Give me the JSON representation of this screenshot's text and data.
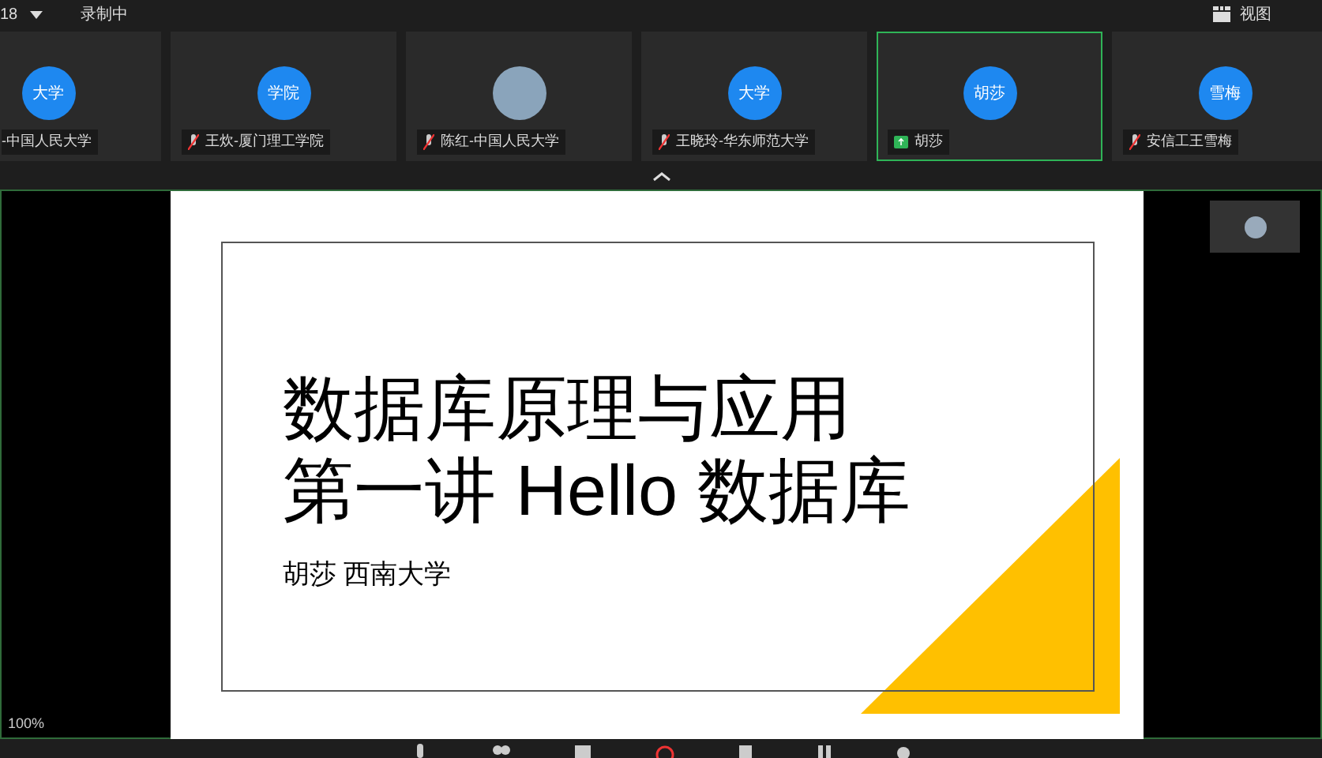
{
  "top_bar": {
    "time": "18",
    "recording": "录制中",
    "view_button": "视图"
  },
  "participants": [
    {
      "kind": "initials",
      "avatar": "大学",
      "name": "-中国人民大学",
      "selected": false
    },
    {
      "kind": "initials",
      "avatar": "学院",
      "name": "王炊-厦门理工学院",
      "muted": true,
      "selected": false
    },
    {
      "kind": "photo",
      "name": "陈红-中国人民大学",
      "muted": true,
      "selected": false
    },
    {
      "kind": "initials",
      "avatar": "大学",
      "name": "王晓玲-华东师范大学",
      "muted": true,
      "selected": false
    },
    {
      "kind": "initials",
      "avatar": "胡莎",
      "name": "胡莎",
      "sharing": true,
      "selected": true
    },
    {
      "kind": "initials",
      "avatar": "雪梅",
      "name": "安信工王雪梅",
      "muted": true,
      "selected": false
    }
  ],
  "slide": {
    "title_lines": [
      "数据库原理与应用",
      "第一讲 Hello 数据库"
    ],
    "subtitle": "胡莎 西南大学"
  },
  "zoom_level": "100%"
}
